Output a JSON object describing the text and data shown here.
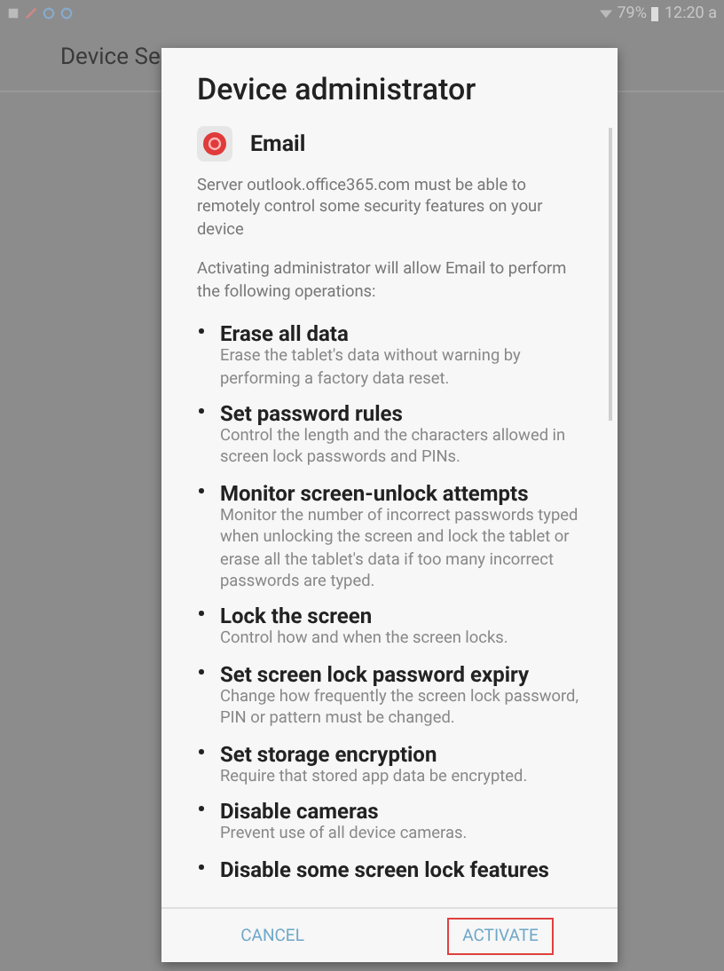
{
  "status_bar": {
    "battery": "79%",
    "time": "12:20 a"
  },
  "header": {
    "title": "Device Se"
  },
  "dialog": {
    "title": "Device administrator",
    "app": {
      "name": "Email"
    },
    "paragraphs": [
      "Server outlook.office365.com must be able to remotely control some security features on your device",
      "Activating administrator will allow Email to perform the following operations:"
    ],
    "operations": [
      {
        "title": "Erase all data",
        "description": "Erase the tablet's data without warning by performing a factory data reset."
      },
      {
        "title": "Set password rules",
        "description": "Control the length and the characters allowed in screen lock passwords and PINs."
      },
      {
        "title": "Monitor screen-unlock attempts",
        "description": "Monitor the number of incorrect passwords typed when unlocking the screen and lock the tablet or erase all the tablet's data if too many incorrect passwords are typed."
      },
      {
        "title": "Lock the screen",
        "description": "Control how and when the screen locks."
      },
      {
        "title": "Set screen lock password expiry",
        "description": "Change how frequently the screen lock password, PIN or pattern must be changed."
      },
      {
        "title": "Set storage encryption",
        "description": "Require that stored app data be encrypted."
      },
      {
        "title": "Disable cameras",
        "description": "Prevent use of all device cameras."
      },
      {
        "title": "Disable some screen lock features"
      }
    ],
    "buttons": [
      {
        "label": "CANCEL",
        "highlighted": false
      },
      {
        "label": "ACTIVATE",
        "highlighted": true
      }
    ]
  }
}
